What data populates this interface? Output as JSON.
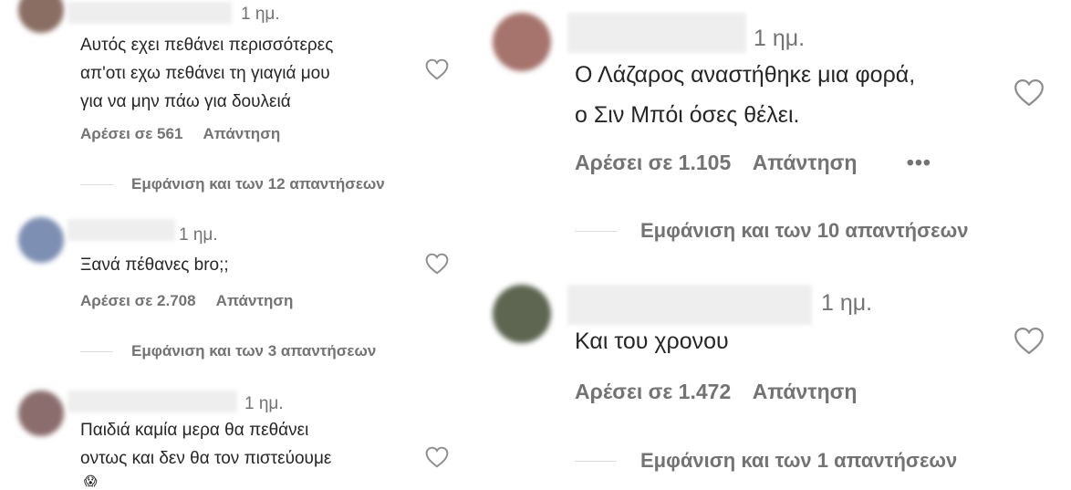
{
  "left_comments": [
    {
      "time": "1 ημ.",
      "lines": [
        "Αυτός εχει πεθάνει περισσότερες",
        "απ'οτι εχω πεθάνει τη γιαγιά μου",
        "για να μην πάω για δουλειά"
      ],
      "likes_label": "Αρέσει σε 561",
      "reply_label": "Απάντηση",
      "view_replies": "Εμφάνιση και των 12 απαντήσεων",
      "avatar_color": "#8a6e63"
    },
    {
      "time": "1 ημ.",
      "lines": [
        "Ξανά πέθανες bro;;"
      ],
      "likes_label": "Αρέσει σε 2.708",
      "reply_label": "Απάντηση",
      "view_replies": "Εμφάνιση και των 3 απαντήσεων",
      "avatar_color": "#7d8fb3"
    },
    {
      "time": "1 ημ.",
      "lines": [
        "Παιδιά καμία μερα θα πεθάνει",
        "οντως και δεν θα τον πιστεύουμε"
      ],
      "emoji": "😱",
      "avatar_color": "#8b6d6d"
    }
  ],
  "right_comments": [
    {
      "time": "1 ημ.",
      "lines": [
        "Ο Λάζαρος αναστήθηκε μια φορά,",
        "ο Σιν Μπόι όσες θέλει."
      ],
      "likes_label": "Αρέσει σε 1.105",
      "reply_label": "Απάντηση",
      "more": "•••",
      "view_replies": "Εμφάνιση και των 10 απαντήσεων",
      "avatar_color": "#a6746c"
    },
    {
      "time": "1 ημ.",
      "lines": [
        "Και του χρονου"
      ],
      "likes_label": "Αρέσει σε 1.472",
      "reply_label": "Απάντηση",
      "view_replies": "Εμφάνιση και των 1 απαντήσεων",
      "avatar_color": "#5e6652"
    }
  ],
  "colors": {
    "text": "#262626",
    "secondary": "#737373",
    "divider": "#dbdbdb",
    "heart": "#8e8e8e"
  },
  "icons": {
    "like": "heart-outline-icon",
    "options": "more-horizontal-icon"
  }
}
